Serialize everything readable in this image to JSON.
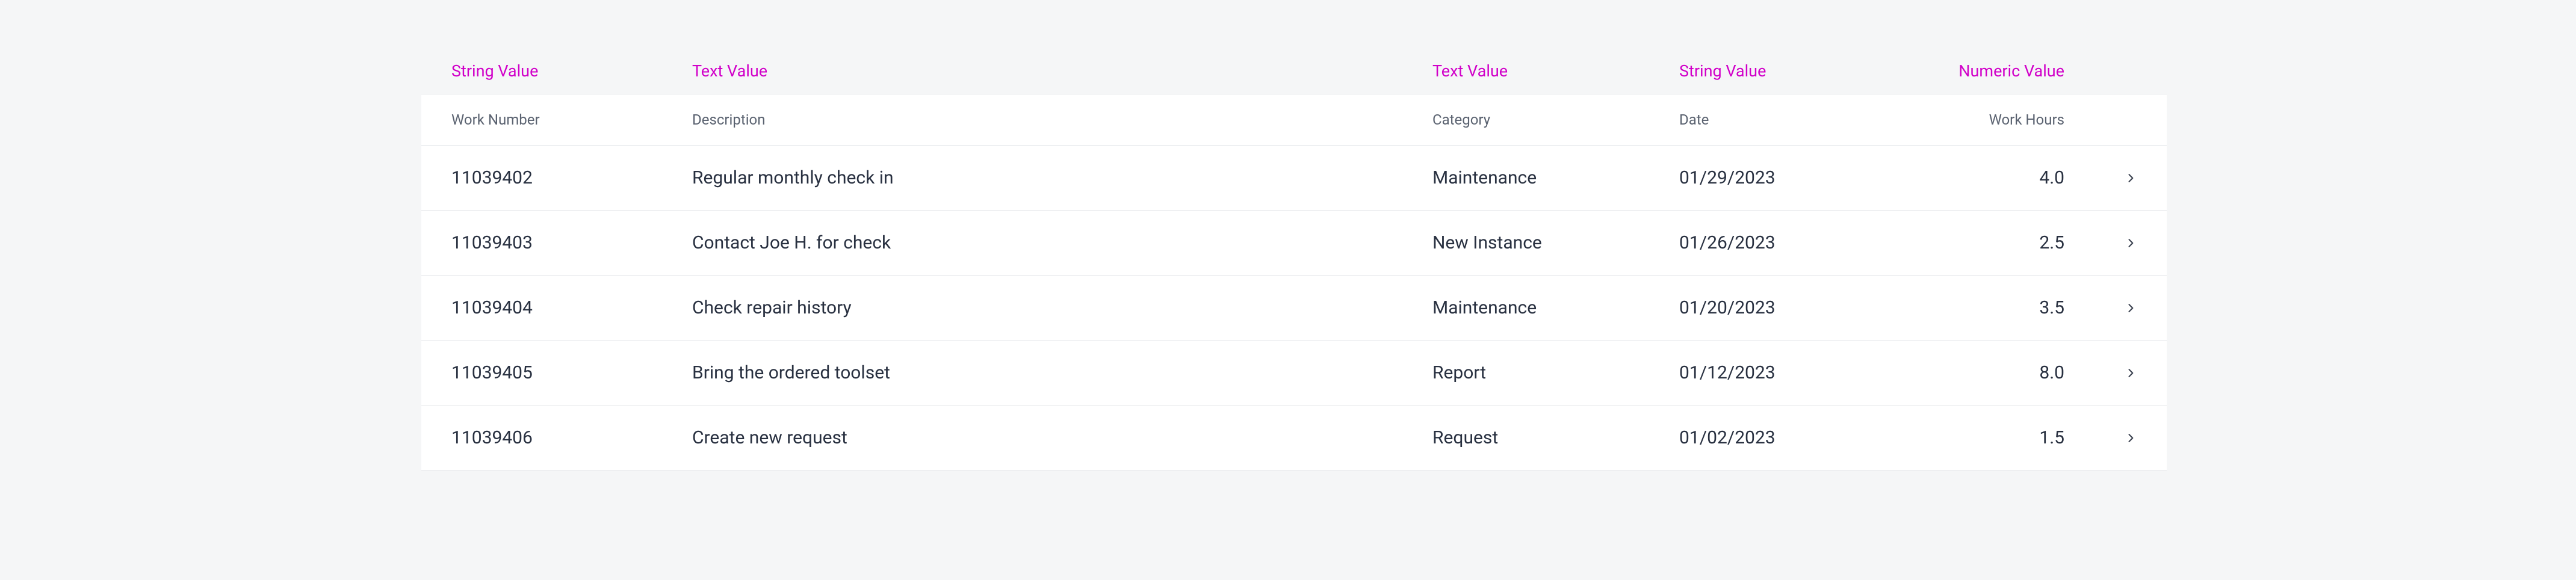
{
  "table": {
    "meta": {
      "work_number": "String Value",
      "description": "Text Value",
      "category": "Text Value",
      "date": "String Value",
      "work_hours": "Numeric Value"
    },
    "headers": {
      "work_number": "Work Number",
      "description": "Description",
      "category": "Category",
      "date": "Date",
      "work_hours": "Work Hours"
    },
    "rows": [
      {
        "work_number": "11039402",
        "description": "Regular monthly check in",
        "category": "Maintenance",
        "date": "01/29/2023",
        "work_hours": "4.0"
      },
      {
        "work_number": "11039403",
        "description": "Contact Joe H. for check",
        "category": "New Instance",
        "date": "01/26/2023",
        "work_hours": "2.5"
      },
      {
        "work_number": "11039404",
        "description": "Check repair history",
        "category": "Maintenance",
        "date": "01/20/2023",
        "work_hours": "3.5"
      },
      {
        "work_number": "11039405",
        "description": "Bring the ordered toolset",
        "category": "Report",
        "date": "01/12/2023",
        "work_hours": "8.0"
      },
      {
        "work_number": "11039406",
        "description": "Create new request",
        "category": "Request",
        "date": "01/02/2023",
        "work_hours": "1.5"
      }
    ]
  }
}
